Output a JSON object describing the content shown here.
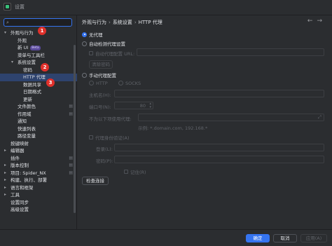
{
  "window": {
    "title": "设置"
  },
  "search": {
    "placeholder": ""
  },
  "sidebar": {
    "items": [
      {
        "label": "外观与行为",
        "indent": 0,
        "expand": "▾"
      },
      {
        "label": "外观",
        "indent": 1
      },
      {
        "label": "新 UI",
        "indent": 1,
        "badge": "Beta"
      },
      {
        "label": "菜单与工具栏",
        "indent": 1
      },
      {
        "label": "系统设置",
        "indent": 1,
        "expand": "▾"
      },
      {
        "label": "密码",
        "indent": 2
      },
      {
        "label": "HTTP 代理",
        "indent": 2,
        "selected": true
      },
      {
        "label": "数据共享",
        "indent": 2
      },
      {
        "label": "日期格式",
        "indent": 2
      },
      {
        "label": "更新",
        "indent": 2
      },
      {
        "label": "文件颜色",
        "indent": 1,
        "config": true
      },
      {
        "label": "作用域",
        "indent": 1,
        "config": true
      },
      {
        "label": "通知",
        "indent": 1
      },
      {
        "label": "快速列表",
        "indent": 1
      },
      {
        "label": "路径变量",
        "indent": 1
      },
      {
        "label": "按键映射",
        "indent": 0
      },
      {
        "label": "编辑器",
        "indent": 0,
        "expand": "▸"
      },
      {
        "label": "插件",
        "indent": 0,
        "config": true
      },
      {
        "label": "版本控制",
        "indent": 0,
        "expand": "▸",
        "config": true
      },
      {
        "label": "项目: Spider_NX",
        "indent": 0,
        "expand": "▸",
        "config": true
      },
      {
        "label": "构建、执行、部署",
        "indent": 0,
        "expand": "▸"
      },
      {
        "label": "语言和框架",
        "indent": 0,
        "expand": "▸"
      },
      {
        "label": "工具",
        "indent": 0,
        "expand": "▸"
      },
      {
        "label": "设置同步",
        "indent": 0
      },
      {
        "label": "高级设置",
        "indent": 0
      }
    ]
  },
  "markers": [
    "1",
    "2",
    "3"
  ],
  "breadcrumb": {
    "part1": "外观与行为",
    "part2": "系统设置",
    "part3": "HTTP 代理",
    "sep": "›"
  },
  "nav": {
    "back": "←",
    "forward": "→"
  },
  "proxy": {
    "no_proxy": "无代理",
    "auto_detect": "自动检测代理设置",
    "auto_config_url": "自动代理配置 URL:",
    "clear_passwords": "清除密码",
    "manual": "手动代理配置",
    "http": "HTTP",
    "socks": "SOCKS",
    "host_label": "主机名(H):",
    "port_label": "端口号(N):",
    "port_value": "80",
    "no_proxy_for": "不为以下项使用代理:",
    "example": "示例: *.domain.com, 192.168.*",
    "auth": "代理身份验证(A)",
    "login": "登录(L):",
    "password": "密码(P):",
    "remember": "记住(R)",
    "check_connection": "检查连接"
  },
  "footer": {
    "ok": "确定",
    "cancel": "取消",
    "apply": "应用(A)"
  },
  "colors": {
    "accent": "#3574f0",
    "selected": "#2e436e",
    "marker": "#e0302b"
  }
}
